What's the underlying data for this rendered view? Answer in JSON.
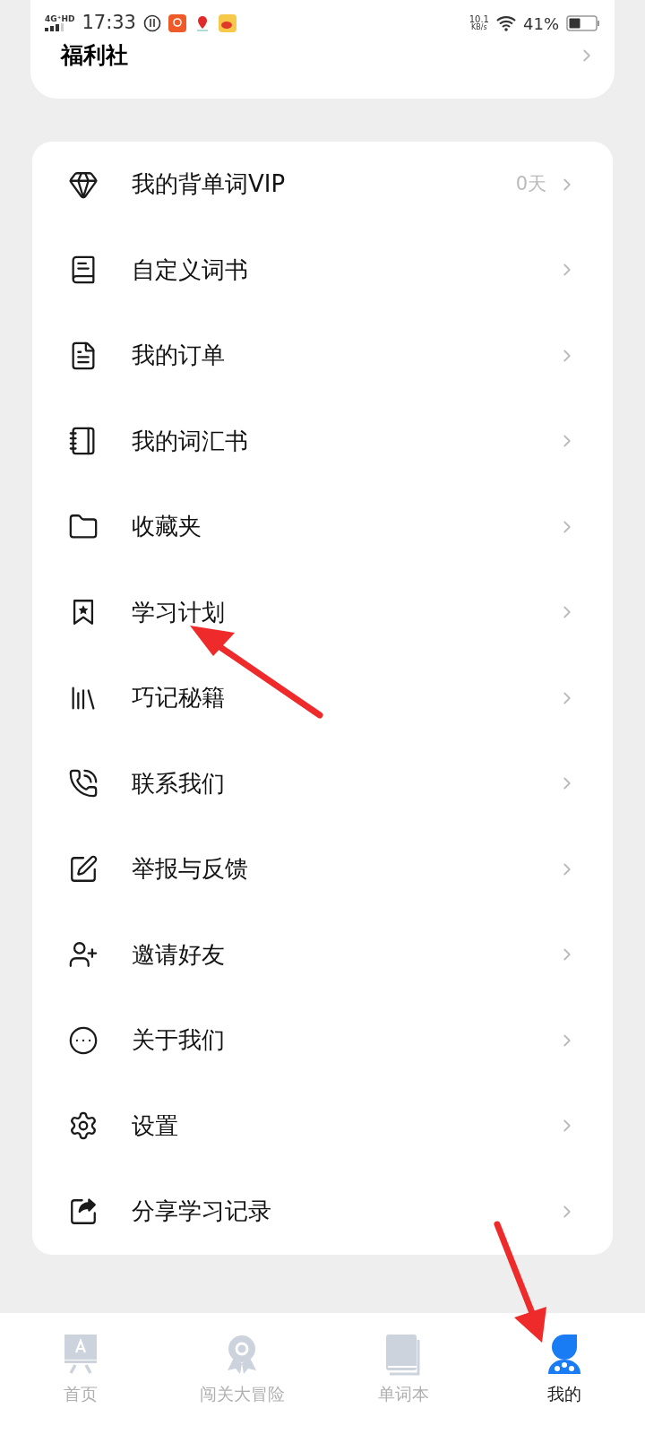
{
  "status_bar": {
    "network": "4G⁺HD",
    "time": "17:33",
    "speed": "10.1",
    "speed_unit": "KB/s",
    "battery": "41%"
  },
  "welfare_card": {
    "title": "福利社"
  },
  "menu": [
    {
      "label": "我的背单词VIP",
      "value": "0天"
    },
    {
      "label": "自定义词书"
    },
    {
      "label": "我的订单"
    },
    {
      "label": "我的词汇书"
    },
    {
      "label": "收藏夹"
    },
    {
      "label": "学习计划"
    },
    {
      "label": "巧记秘籍"
    },
    {
      "label": "联系我们"
    },
    {
      "label": "举报与反馈"
    },
    {
      "label": "邀请好友"
    },
    {
      "label": "关于我们"
    },
    {
      "label": "设置"
    },
    {
      "label": "分享学习记录"
    }
  ],
  "bottom_nav": [
    {
      "label": "首页",
      "selected": false
    },
    {
      "label": "闯关大冒险",
      "selected": false
    },
    {
      "label": "单词本",
      "selected": false
    },
    {
      "label": "我的",
      "selected": true
    }
  ]
}
